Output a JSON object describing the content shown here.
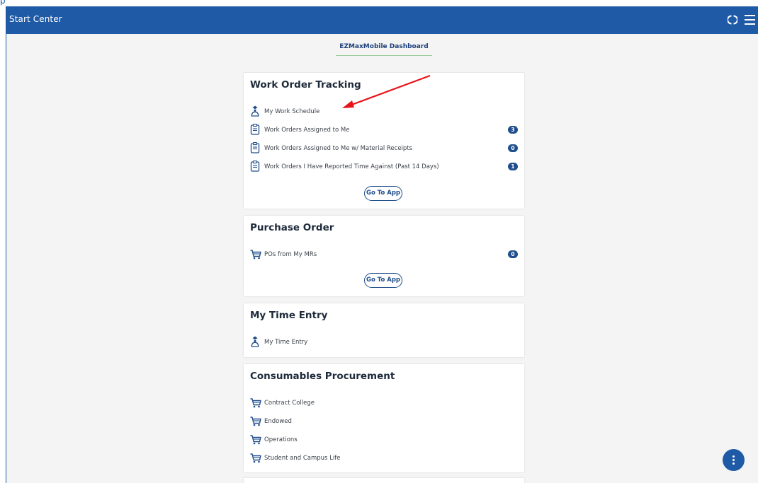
{
  "header": {
    "title": "Start Center",
    "sync_icon": "sync-icon",
    "menu_icon": "hamburger-menu-icon",
    "color": "#1f5aa6"
  },
  "dashboard_tab": "EZMaxMobile Dashboard",
  "cards": {
    "work_order": {
      "title": "Work Order Tracking",
      "items": [
        {
          "label": "My Work Schedule",
          "icon": "person-icon"
        },
        {
          "label": "Work Orders Assigned to Me",
          "icon": "clipboard-icon",
          "count": "3"
        },
        {
          "label": "Work Orders Assigned to Me w/ Material Receipts",
          "icon": "clipboard-icon",
          "count": "0"
        },
        {
          "label": "Work Orders I Have Reported Time Against (Past 14 Days)",
          "icon": "clipboard-icon",
          "count": "1"
        }
      ],
      "button": "Go To App"
    },
    "purchase_order": {
      "title": "Purchase Order",
      "items": [
        {
          "label": "POs from My MRs",
          "icon": "cart-icon",
          "count": "0"
        }
      ],
      "button": "Go To App"
    },
    "time_entry": {
      "title": "My Time Entry",
      "items": [
        {
          "label": "My Time Entry",
          "icon": "person-icon"
        }
      ]
    },
    "consumables": {
      "title": "Consumables Procurement",
      "items": [
        {
          "label": "Contract College",
          "icon": "cart-icon"
        },
        {
          "label": "Endowed",
          "icon": "cart-icon"
        },
        {
          "label": "Operations",
          "icon": "cart-icon"
        },
        {
          "label": "Student and Campus Life",
          "icon": "cart-icon"
        }
      ]
    }
  },
  "fab_icon": "more-vertical-icon",
  "annotation": {
    "arrow_color": "#e8141b"
  }
}
